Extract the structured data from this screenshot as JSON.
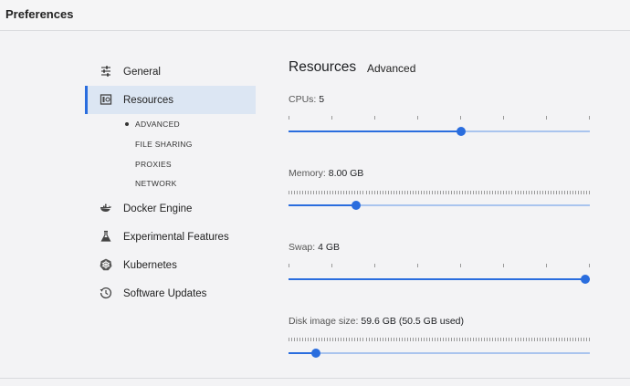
{
  "window": {
    "title": "Preferences"
  },
  "sidebar": {
    "items": [
      {
        "label": "General",
        "icon": "sliders-icon"
      },
      {
        "label": "Resources",
        "icon": "resources-icon",
        "active": true
      },
      {
        "label": "Docker Engine",
        "icon": "whale-icon"
      },
      {
        "label": "Experimental Features",
        "icon": "flask-icon"
      },
      {
        "label": "Kubernetes",
        "icon": "helm-icon"
      },
      {
        "label": "Software Updates",
        "icon": "history-icon"
      }
    ],
    "subitems": [
      {
        "label": "ADVANCED",
        "active": true
      },
      {
        "label": "FILE SHARING"
      },
      {
        "label": "PROXIES"
      },
      {
        "label": "NETWORK"
      }
    ]
  },
  "main": {
    "heading": "Resources",
    "tab": "Advanced",
    "settings": {
      "cpus": {
        "label": "CPUs:",
        "value": "5",
        "min": 1,
        "max": 8,
        "current": 5
      },
      "memory": {
        "label": "Memory:",
        "value": "8.00 GB",
        "fraction": 0.225
      },
      "swap": {
        "label": "Swap:",
        "value": "4 GB",
        "fraction": 1.0
      },
      "disk": {
        "label": "Disk image size:",
        "value": "59.6 GB (50.5 GB used)",
        "fraction": 0.09
      }
    }
  },
  "colors": {
    "accent": "#2a6dde",
    "track": "#a9c4ee",
    "active_bg": "#dce6f3"
  }
}
